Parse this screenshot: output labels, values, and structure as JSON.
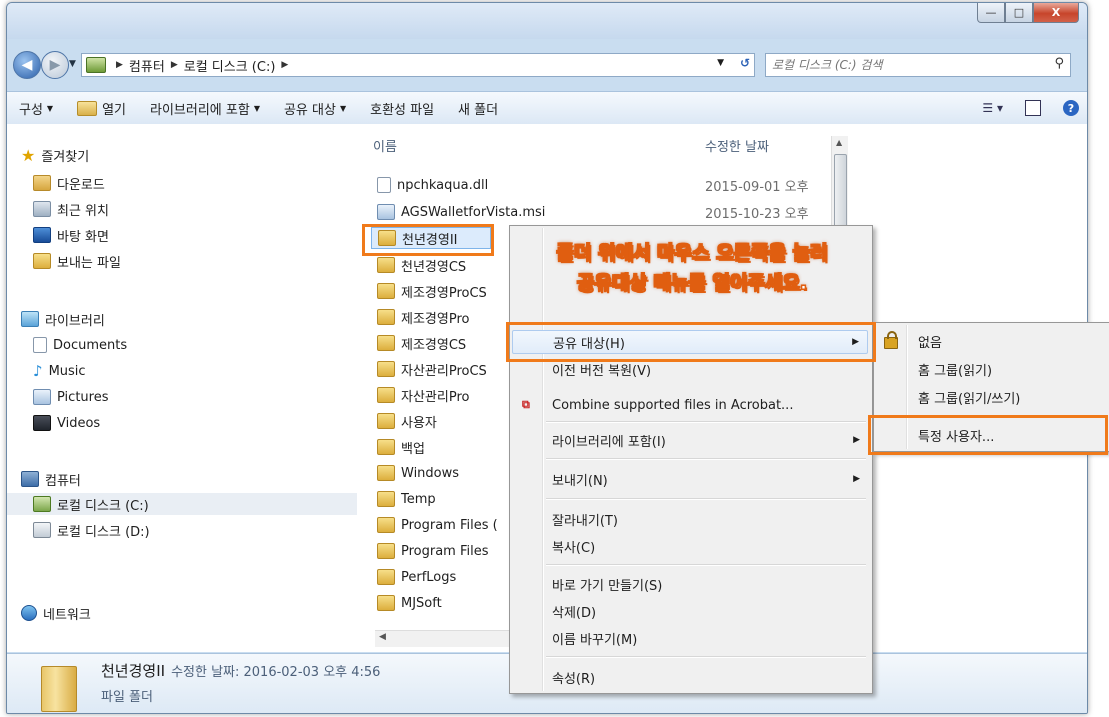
{
  "window": {
    "controls": {
      "minimize": "—",
      "maximize": "□",
      "close": "X"
    }
  },
  "address": {
    "crumbs": [
      "컴퓨터",
      "로컬 디스크 (C:)"
    ],
    "search_placeholder": "로컬 디스크 (C:) 검색"
  },
  "toolbar": {
    "organize": "구성",
    "open": "열기",
    "include_library": "라이브러리에 포함",
    "share_with": "공유 대상",
    "compat_files": "호환성 파일",
    "new_folder": "새 폴더"
  },
  "nav": {
    "favorites": "즐겨찾기",
    "downloads": "다운로드",
    "recent": "최근 위치",
    "desktop": "바탕 화면",
    "sent": "보내는 파일",
    "libraries": "라이브러리",
    "documents": "Documents",
    "music": "Music",
    "pictures": "Pictures",
    "videos": "Videos",
    "computer": "컴퓨터",
    "drive_c": "로컬 디스크 (C:)",
    "drive_d": "로컬 디스크 (D:)",
    "network": "네트워크"
  },
  "files": {
    "col_name": "이름",
    "col_date": "수정한 날짜",
    "rows": [
      {
        "name": "npchkaqua.dll",
        "date": "2015-09-01 오후"
      },
      {
        "name": "AGSWalletforVista.msi",
        "date": "2015-10-23 오후"
      },
      {
        "name": "천년경영II",
        "date": ""
      },
      {
        "name": "천년경영CS",
        "date": ""
      },
      {
        "name": "제조경영ProCS",
        "date": ""
      },
      {
        "name": "제조경영Pro",
        "date": ""
      },
      {
        "name": "제조경영CS",
        "date": ""
      },
      {
        "name": "자산관리ProCS",
        "date": ""
      },
      {
        "name": "자산관리Pro",
        "date": ""
      },
      {
        "name": "사용자",
        "date": ""
      },
      {
        "name": "백업",
        "date": ""
      },
      {
        "name": "Windows",
        "date": ""
      },
      {
        "name": "Temp",
        "date": ""
      },
      {
        "name": "Program Files (",
        "date": ""
      },
      {
        "name": "Program Files",
        "date": ""
      },
      {
        "name": "PerfLogs",
        "date": ""
      },
      {
        "name": "MJSoft",
        "date": ""
      }
    ]
  },
  "context_menu": {
    "share_with": "공유 대상(H)",
    "restore": "이전 버전 복원(V)",
    "acrobat": "Combine supported files in Acrobat...",
    "include_library": "라이브러리에 포함(I)",
    "send_to": "보내기(N)",
    "cut": "잘라내기(T)",
    "copy": "복사(C)",
    "shortcut": "바로 가기 만들기(S)",
    "delete": "삭제(D)",
    "rename": "이름 바꾸기(M)",
    "properties": "속성(R)"
  },
  "submenu": {
    "nobody": "없음",
    "home_read": "홈 그룹(읽기)",
    "home_rw": "홈 그룹(읽기/쓰기)",
    "specific": "특정 사용자..."
  },
  "status": {
    "name": "천년경영II",
    "meta": "수정한 날짜: 2016-02-03 오후 4:56",
    "type": "파일 폴더"
  },
  "callout": {
    "line1_a": "폴더 위에서 마우스 ",
    "line1_b": "오른쪽",
    "line1_c": "을 눌러",
    "line2_a": "공유대상",
    "line2_b": " 메뉴를 열어주세요."
  },
  "colors": {
    "highlight": "#f07a1a",
    "selection": "#dcebfc"
  }
}
